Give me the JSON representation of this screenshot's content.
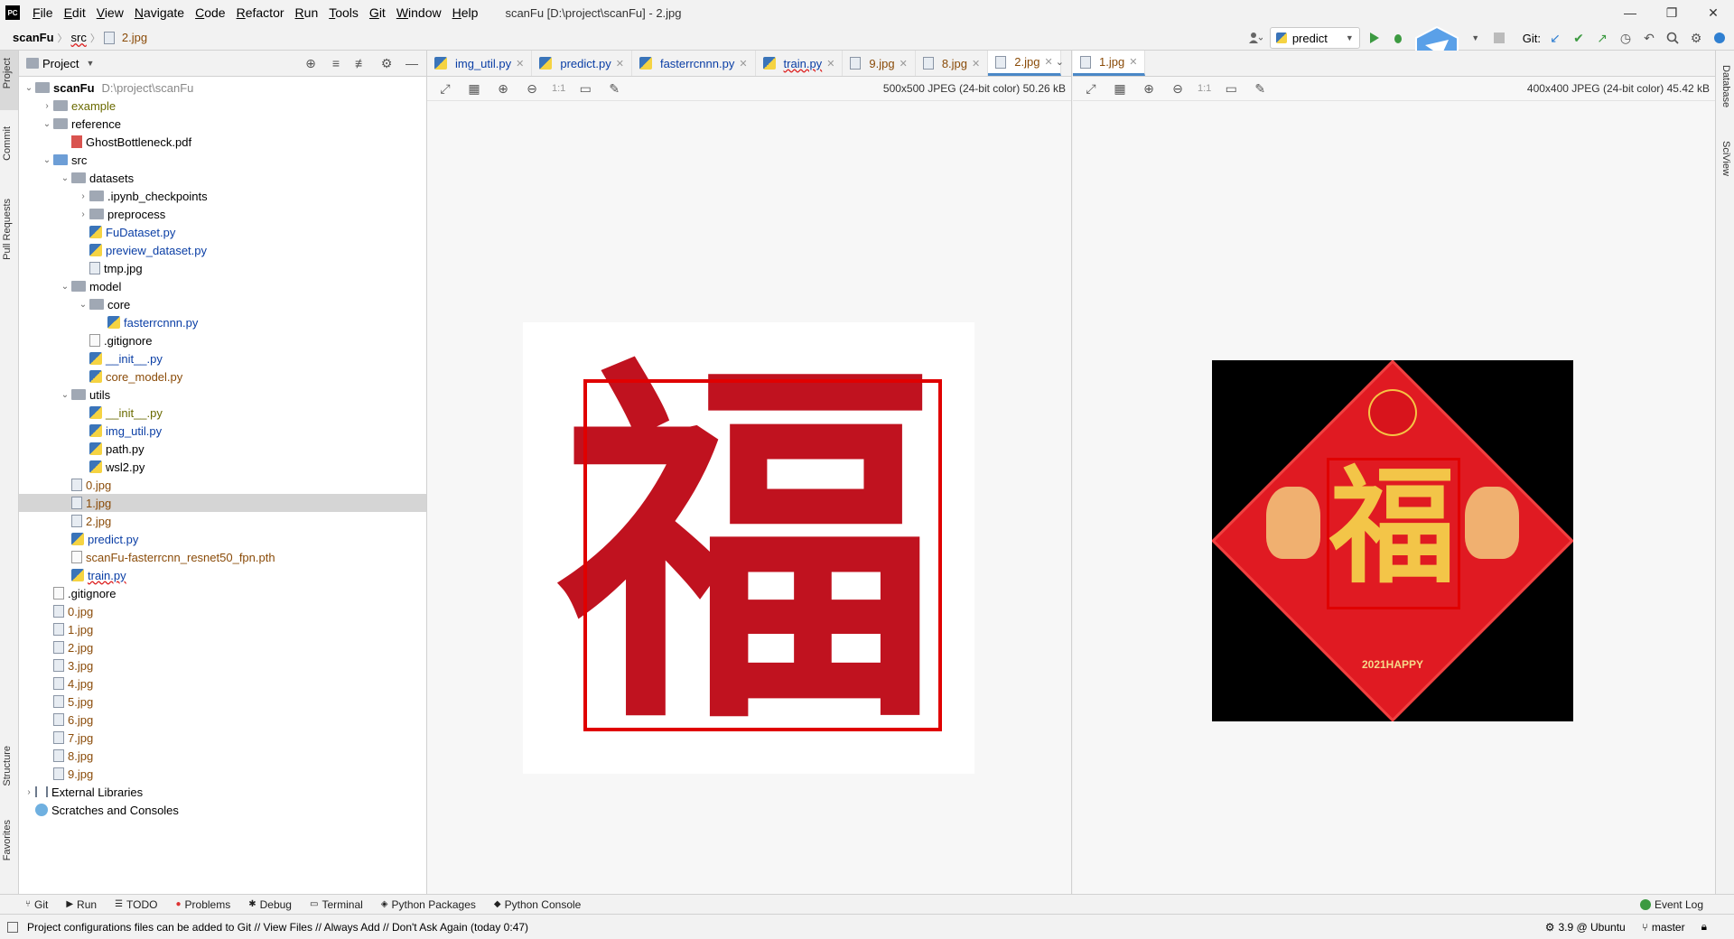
{
  "app": {
    "logo_text": "PC",
    "window_title": "scanFu [D:\\project\\scanFu] - 2.jpg",
    "menu": [
      "File",
      "Edit",
      "View",
      "Navigate",
      "Code",
      "Refactor",
      "Run",
      "Tools",
      "Git",
      "Window",
      "Help"
    ],
    "window_controls": [
      "—",
      "❐",
      "✕"
    ]
  },
  "nav": {
    "breadcrumbs": [
      "scanFu",
      "src",
      "2.jpg"
    ],
    "run_config": "predict",
    "git_label": "Git:"
  },
  "left_stripe": {
    "project": "Project",
    "commit": "Commit",
    "pull_requests": "Pull Requests",
    "structure": "Structure",
    "favorites": "Favorites"
  },
  "right_stripe": {
    "database": "Database",
    "sciview": "SciView"
  },
  "project_panel": {
    "title": "Project",
    "tree": [
      {
        "level": 0,
        "arrow": "v",
        "icon": "folder",
        "name": "scanFu",
        "extra": "D:\\project\\scanFu",
        "bold": true
      },
      {
        "level": 1,
        "arrow": ">",
        "icon": "folder",
        "name": "example",
        "color": "olive"
      },
      {
        "level": 1,
        "arrow": "v",
        "icon": "folder",
        "name": "reference"
      },
      {
        "level": 2,
        "arrow": "",
        "icon": "pdf",
        "name": "GhostBottleneck.pdf"
      },
      {
        "level": 1,
        "arrow": "v",
        "icon": "folder-blue",
        "name": "src"
      },
      {
        "level": 2,
        "arrow": "v",
        "icon": "folder",
        "name": "datasets"
      },
      {
        "level": 3,
        "arrow": ">",
        "icon": "folder",
        "name": ".ipynb_checkpoints"
      },
      {
        "level": 3,
        "arrow": ">",
        "icon": "folder",
        "name": "preprocess"
      },
      {
        "level": 3,
        "arrow": "",
        "icon": "py",
        "name": "FuDataset.py",
        "color": "blue"
      },
      {
        "level": 3,
        "arrow": "",
        "icon": "py",
        "name": "preview_dataset.py",
        "color": "blue"
      },
      {
        "level": 3,
        "arrow": "",
        "icon": "img",
        "name": "tmp.jpg"
      },
      {
        "level": 2,
        "arrow": "v",
        "icon": "folder",
        "name": "model"
      },
      {
        "level": 3,
        "arrow": "v",
        "icon": "folder",
        "name": "core"
      },
      {
        "level": 4,
        "arrow": "",
        "icon": "py",
        "name": "fasterrcnnn.py",
        "color": "blue"
      },
      {
        "level": 3,
        "arrow": "",
        "icon": "file",
        "name": ".gitignore"
      },
      {
        "level": 3,
        "arrow": "",
        "icon": "py",
        "name": "__init__.py",
        "color": "blue"
      },
      {
        "level": 3,
        "arrow": "",
        "icon": "py",
        "name": "core_model.py",
        "color": "brown"
      },
      {
        "level": 2,
        "arrow": "v",
        "icon": "folder",
        "name": "utils"
      },
      {
        "level": 3,
        "arrow": "",
        "icon": "py",
        "name": "__init__.py",
        "color": "olive"
      },
      {
        "level": 3,
        "arrow": "",
        "icon": "py",
        "name": "img_util.py",
        "color": "blue"
      },
      {
        "level": 3,
        "arrow": "",
        "icon": "py",
        "name": "path.py"
      },
      {
        "level": 3,
        "arrow": "",
        "icon": "py",
        "name": "wsl2.py"
      },
      {
        "level": 2,
        "arrow": "",
        "icon": "img",
        "name": "0.jpg",
        "color": "brown"
      },
      {
        "level": 2,
        "arrow": "",
        "icon": "img",
        "name": "1.jpg",
        "color": "brown",
        "selected": true
      },
      {
        "level": 2,
        "arrow": "",
        "icon": "img",
        "name": "2.jpg",
        "color": "brown"
      },
      {
        "level": 2,
        "arrow": "",
        "icon": "py",
        "name": "predict.py",
        "color": "blue"
      },
      {
        "level": 2,
        "arrow": "",
        "icon": "file",
        "name": "scanFu-fasterrcnn_resnet50_fpn.pth",
        "color": "brown"
      },
      {
        "level": 2,
        "arrow": "",
        "icon": "py",
        "name": "train.py",
        "color": "blue",
        "wavy": true
      },
      {
        "level": 1,
        "arrow": "",
        "icon": "file",
        "name": ".gitignore"
      },
      {
        "level": 1,
        "arrow": "",
        "icon": "img",
        "name": "0.jpg",
        "color": "brown"
      },
      {
        "level": 1,
        "arrow": "",
        "icon": "img",
        "name": "1.jpg",
        "color": "brown"
      },
      {
        "level": 1,
        "arrow": "",
        "icon": "img",
        "name": "2.jpg",
        "color": "brown"
      },
      {
        "level": 1,
        "arrow": "",
        "icon": "img",
        "name": "3.jpg",
        "color": "brown"
      },
      {
        "level": 1,
        "arrow": "",
        "icon": "img",
        "name": "4.jpg",
        "color": "brown"
      },
      {
        "level": 1,
        "arrow": "",
        "icon": "img",
        "name": "5.jpg",
        "color": "brown"
      },
      {
        "level": 1,
        "arrow": "",
        "icon": "img",
        "name": "6.jpg",
        "color": "brown"
      },
      {
        "level": 1,
        "arrow": "",
        "icon": "img",
        "name": "7.jpg",
        "color": "brown"
      },
      {
        "level": 1,
        "arrow": "",
        "icon": "img",
        "name": "8.jpg",
        "color": "brown"
      },
      {
        "level": 1,
        "arrow": "",
        "icon": "img",
        "name": "9.jpg",
        "color": "brown"
      },
      {
        "level": 0,
        "arrow": ">",
        "icon": "lib",
        "name": "External Libraries"
      },
      {
        "level": 0,
        "arrow": "",
        "icon": "scratch",
        "name": "Scratches and Consoles"
      }
    ]
  },
  "editor_left": {
    "tabs": [
      {
        "name": "img_util.py"
      },
      {
        "name": "predict.py"
      },
      {
        "name": "fasterrcnnn.py"
      },
      {
        "name": "train.py",
        "wavy": true
      },
      {
        "name": "9.jpg"
      },
      {
        "name": "8.jpg"
      },
      {
        "name": "2.jpg",
        "active": true
      }
    ],
    "image_info": "500x500 JPEG (24-bit color) 50.26 kB",
    "image_label": "1:1",
    "fu_char": "福"
  },
  "editor_right": {
    "tabs": [
      {
        "name": "1.jpg",
        "active": true
      }
    ],
    "image_info": "400x400 JPEG (24-bit color) 45.42 kB",
    "image_label": "1:1",
    "fu_char": "福",
    "year_text": "2021HAPPY"
  },
  "bottom_tools": [
    {
      "icon": "git-icon",
      "label": "Git"
    },
    {
      "icon": "run-icon",
      "label": "Run"
    },
    {
      "icon": "todo-icon",
      "label": "TODO"
    },
    {
      "icon": "problems-icon",
      "label": "Problems"
    },
    {
      "icon": "debug-icon",
      "label": "Debug"
    },
    {
      "icon": "terminal-icon",
      "label": "Terminal"
    },
    {
      "icon": "python-packages-icon",
      "label": "Python Packages"
    },
    {
      "icon": "python-console-icon",
      "label": "Python Console"
    }
  ],
  "event_log": "Event Log",
  "status": {
    "message": "Project configurations files can be added to Git // View Files // Always Add // Don't Ask Again (today 0:47)",
    "interpreter": "3.9 @ Ubuntu",
    "branch": "master"
  },
  "colors": {
    "accent": "#4a88c7",
    "bbox_red": "#e00000",
    "fu_red": "#c0121f",
    "run_green": "#3c9a41"
  }
}
